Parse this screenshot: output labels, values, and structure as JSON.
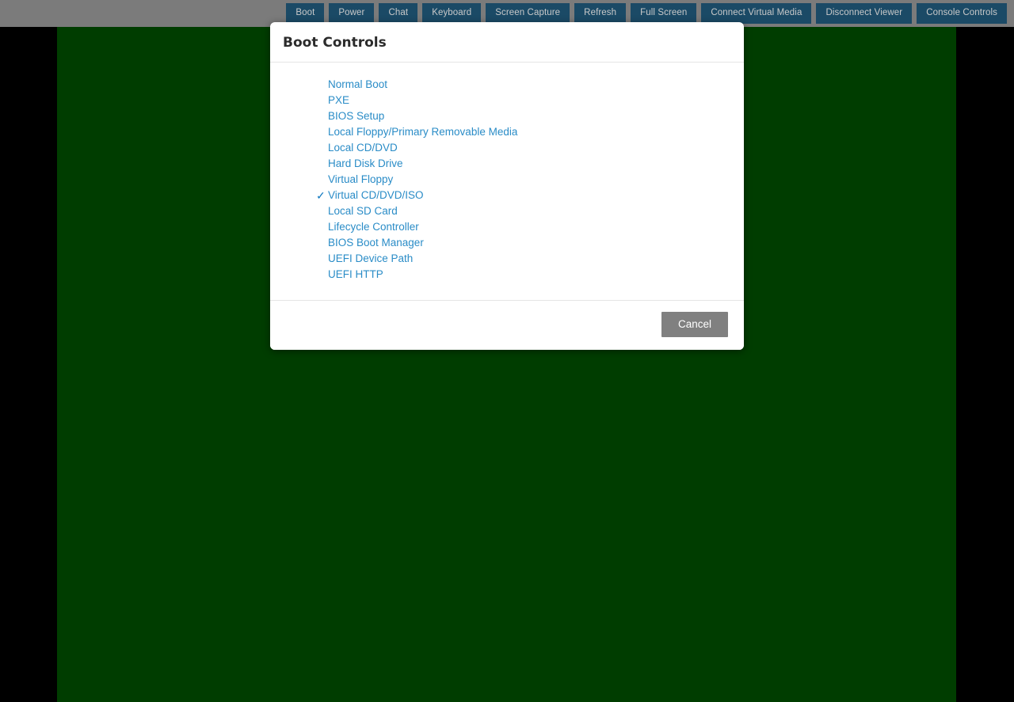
{
  "toolbar": {
    "buttons": [
      {
        "label": "Boot"
      },
      {
        "label": "Power"
      },
      {
        "label": "Chat"
      },
      {
        "label": "Keyboard"
      },
      {
        "label": "Screen Capture"
      },
      {
        "label": "Refresh"
      },
      {
        "label": "Full Screen"
      },
      {
        "label": "Connect Virtual Media"
      },
      {
        "label": "Disconnect Viewer"
      },
      {
        "label": "Console Controls"
      }
    ],
    "background_color": "#7b7b7b",
    "button_color": "#1b4a66",
    "button_text_color": "#c9c9c9"
  },
  "console": {
    "background_color": "#003d00"
  },
  "dialog": {
    "title": "Boot Controls",
    "check_glyph": "✓",
    "link_color": "#2a8cc7",
    "items": [
      {
        "label": "Normal Boot",
        "selected": false
      },
      {
        "label": "PXE",
        "selected": false
      },
      {
        "label": "BIOS Setup",
        "selected": false
      },
      {
        "label": "Local Floppy/Primary Removable Media",
        "selected": false
      },
      {
        "label": "Local CD/DVD",
        "selected": false
      },
      {
        "label": "Hard Disk Drive",
        "selected": false
      },
      {
        "label": "Virtual Floppy",
        "selected": false
      },
      {
        "label": "Virtual CD/DVD/ISO",
        "selected": true
      },
      {
        "label": "Local SD Card",
        "selected": false
      },
      {
        "label": "Lifecycle Controller",
        "selected": false
      },
      {
        "label": "BIOS Boot Manager",
        "selected": false
      },
      {
        "label": "UEFI Device Path",
        "selected": false
      },
      {
        "label": "UEFI HTTP",
        "selected": false
      }
    ],
    "cancel_label": "Cancel"
  }
}
